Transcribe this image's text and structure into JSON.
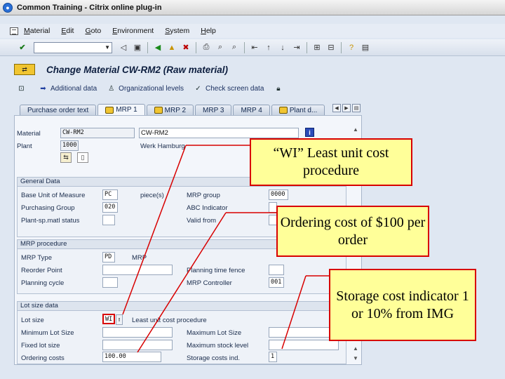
{
  "window": {
    "title": "Common Training - Citrix online plug-in"
  },
  "menu": [
    "Material",
    "Edit",
    "Goto",
    "Environment",
    "System",
    "Help"
  ],
  "screen_title": "Change Material CW-RM2 (Raw material)",
  "app_toolbar": {
    "additional_data": "Additional data",
    "org_levels": "Organizational levels",
    "check_screen": "Check screen data"
  },
  "tabs": [
    {
      "label": "Purchase order text",
      "icon": false,
      "active": false
    },
    {
      "label": "MRP 1",
      "icon": true,
      "active": true
    },
    {
      "label": "MRP 2",
      "icon": true,
      "active": false
    },
    {
      "label": "MRP 3",
      "icon": false,
      "active": false
    },
    {
      "label": "MRP 4",
      "icon": false,
      "active": false
    },
    {
      "label": "Plant d...",
      "icon": true,
      "active": false
    }
  ],
  "header": {
    "material_label": "Material",
    "material_value": "CW-RM2",
    "material_desc": "CW-RM2",
    "plant_label": "Plant",
    "plant_value": "1000",
    "plant_desc": "Werk Hamburg"
  },
  "general": {
    "title": "General Data",
    "base_uom_label": "Base Unit of Measure",
    "base_uom_value": "PC",
    "base_uom_text": "piece(s)",
    "purch_group_label": "Purchasing Group",
    "purch_group_value": "020",
    "plant_status_label": "Plant-sp.matl status",
    "mrp_group_label": "MRP group",
    "mrp_group_value": "0000",
    "abc_label": "ABC Indicator",
    "valid_from_label": "Valid from"
  },
  "mrp_proc": {
    "title": "MRP procedure",
    "mrp_type_label": "MRP Type",
    "mrp_type_value": "PD",
    "mrp_type_text": "MRP",
    "reorder_label": "Reorder Point",
    "planning_cycle_label": "Planning cycle",
    "ptf_label": "Planning time fence",
    "controller_label": "MRP Controller",
    "controller_value": "001"
  },
  "lot_size": {
    "title": "Lot size data",
    "lot_size_label": "Lot size",
    "lot_size_value": "WI",
    "lot_size_text": "Least unit cost procedure",
    "min_label": "Minimum Lot Size",
    "fixed_label": "Fixed lot size",
    "ordering_label": "Ordering costs",
    "ordering_value": "100.00",
    "max_label": "Maximum Lot Size",
    "max_stock_label": "Maximum stock level",
    "storage_label": "Storage costs ind.",
    "storage_value": "1"
  },
  "callouts": {
    "c1": "“WI” Least unit cost procedure",
    "c2": "Ordering cost of $100 per order",
    "c3": "Storage cost indicator 1 or 10% from IMG"
  },
  "colors": {
    "callout_fill": "#ffff99",
    "callout_border": "#d80000",
    "line": "#d80000"
  }
}
